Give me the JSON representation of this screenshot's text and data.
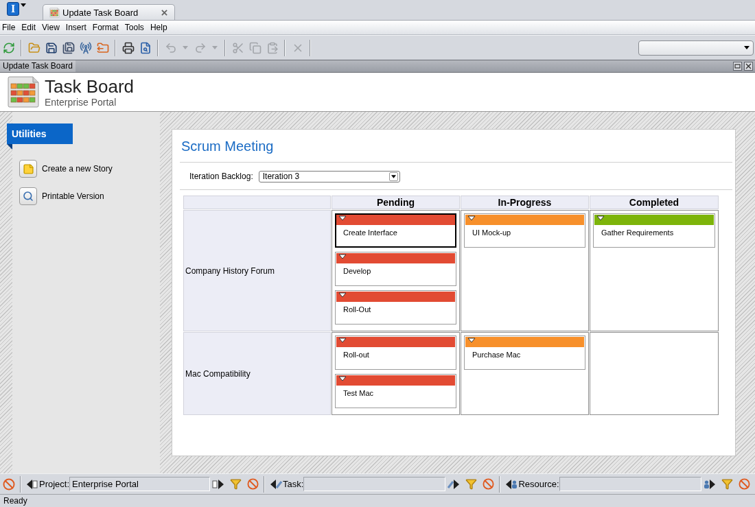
{
  "app_logo": {
    "letter": "I"
  },
  "tabs": [
    {
      "title": "Update Task Board",
      "selected": true
    }
  ],
  "menu": [
    "File",
    "Edit",
    "View",
    "Insert",
    "Format",
    "Tools",
    "Help"
  ],
  "toolbar": [
    [
      {
        "disabled": false
      }
    ],
    [
      {
        "disabled": false
      },
      {
        "disabled": false
      },
      {
        "disabled": false
      },
      {
        "disabled": false
      },
      {
        "disabled": false
      }
    ],
    [
      {
        "disabled": false
      },
      {
        "disabled": false
      }
    ],
    [
      {
        "disabled": true
      },
      {
        "disabled": true
      },
      {
        "disabled": true
      },
      {
        "disabled": true
      }
    ],
    [
      {
        "disabled": true
      },
      {
        "disabled": true
      },
      {
        "disabled": true
      }
    ],
    [
      {
        "disabled": true
      }
    ]
  ],
  "panel": {
    "title": "Update Task Board"
  },
  "header": {
    "title": "Task Board",
    "subtitle": "Enterprise Portal"
  },
  "sidebar": {
    "title": "Utilities",
    "items": [
      {
        "label": "Create a new Story"
      },
      {
        "label": "Printable Version"
      }
    ]
  },
  "meeting": {
    "title": "Scrum Meeting",
    "backlog": {
      "label": "Iteration Backlog:",
      "value": "Iteration 3"
    }
  },
  "board": {
    "columns": [
      "Pending",
      "In-Progress",
      "Completed"
    ],
    "rows": [
      {
        "label": "Company History Forum",
        "cells": [
          {
            "cards": [
              {
                "title": "Create Interface",
                "color": "#e24b33",
                "selected": true
              },
              {
                "title": "Develop",
                "color": "#e24b33",
                "selected": false
              },
              {
                "title": "Roll-Out",
                "color": "#e24b33",
                "selected": false
              }
            ]
          },
          {
            "cards": [
              {
                "title": "UI Mock-up",
                "color": "#f7902b",
                "selected": false
              }
            ]
          },
          {
            "cards": [
              {
                "title": "Gather Requirements",
                "color": "#7db40a",
                "selected": false
              }
            ]
          }
        ]
      },
      {
        "label": "Mac Compatibility",
        "cells": [
          {
            "cards": [
              {
                "title": "Roll-out",
                "color": "#e24b33",
                "selected": false
              },
              {
                "title": "Test Mac",
                "color": "#e24b33",
                "selected": false
              }
            ]
          },
          {
            "cards": [
              {
                "title": "Purchase Mac",
                "color": "#f7902b",
                "selected": false
              }
            ]
          },
          {}
        ]
      }
    ]
  },
  "filter_bar": {
    "project": {
      "label": "Project:",
      "value": "Enterprise Portal"
    },
    "task": {
      "label": "Task:"
    },
    "resource": {
      "label": "Resource:"
    }
  },
  "status_bar": {
    "text": "Ready"
  }
}
